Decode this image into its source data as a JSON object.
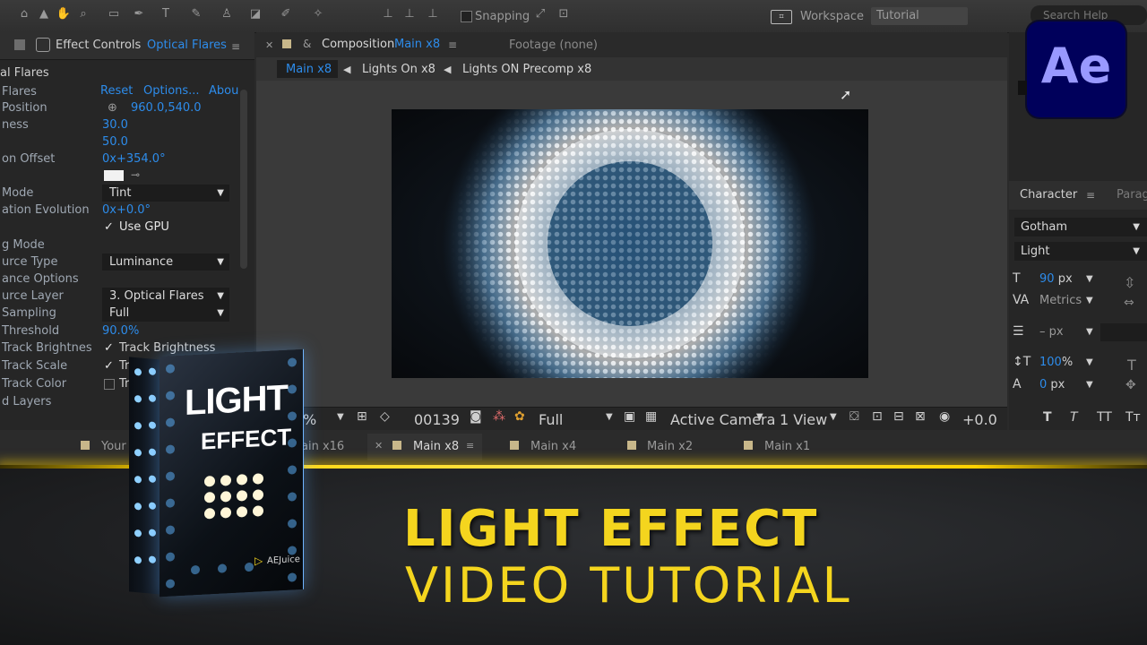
{
  "top_toolbar": {
    "snapping_label": "Snapping",
    "workspace_label": "Workspace",
    "workspace_value": "Tutorial",
    "search_placeholder": "Search Help",
    "icons": [
      "home-icon",
      "selection-tool-icon",
      "hand-tool-icon",
      "zoom-tool-icon",
      "camera-tool-icon",
      "pan-behind-tool-icon",
      "rectangle-tool-icon",
      "pen-tool-icon",
      "type-tool-icon",
      "brush-tool-icon",
      "clone-stamp-tool-icon",
      "eraser-tool-icon",
      "roto-brush-tool-icon",
      "puppet-pin-tool-icon",
      "axis-icon",
      "magnet-icon"
    ]
  },
  "effect_controls": {
    "tab_label": "Effect Controls",
    "layer_name": "Optical Flares",
    "effect_name": "al Flares",
    "reset": "Reset",
    "options": "Options...",
    "about": "Abou",
    "rows": [
      {
        "name": "Flares",
        "value": ""
      },
      {
        "name": "Position",
        "value": "960.0,540.0"
      },
      {
        "name": "ness",
        "value": "30.0"
      },
      {
        "name": "",
        "value": "50.0"
      },
      {
        "name": "on Offset",
        "value": "0x+354.0°"
      },
      {
        "name": "Mode",
        "value": "Tint"
      },
      {
        "name": "ation Evolution",
        "value": "0x+0.0°"
      },
      {
        "name": "",
        "value": "Use GPU"
      },
      {
        "name": "g Mode",
        "value": ""
      },
      {
        "name": "urce Type",
        "value": "Luminance"
      },
      {
        "name": "ance Options",
        "value": ""
      },
      {
        "name": "urce Layer",
        "value": "3. Optical Flares"
      },
      {
        "name": "Sampling",
        "value": "Full"
      },
      {
        "name": "Threshold",
        "value": "90.0%"
      },
      {
        "name": "Track Brightnes",
        "value": "Track Brightness"
      },
      {
        "name": "Track Scale",
        "value": "Tr"
      },
      {
        "name": "Track Color",
        "value": "Tr"
      },
      {
        "name": "d Layers",
        "value": ""
      }
    ]
  },
  "composition": {
    "tab_prefix": "Composition",
    "tab_name": "Main x8",
    "footage_label": "Footage (none)",
    "breadcrumbs": [
      "Main x8",
      "Lights On x8",
      "Lights ON Precomp x8"
    ],
    "footer": {
      "zoom": "%",
      "frame": "00139",
      "resolution": "Full",
      "camera": "Active Camera",
      "view": "1 View",
      "exposure": "+0.0"
    }
  },
  "character_panel": {
    "title": "Character",
    "next_tab": "Parag",
    "font_family": "Gotham",
    "font_style": "Light",
    "font_size": "90",
    "font_size_unit": "px",
    "kerning": "Metrics",
    "leading": "– px",
    "vertical_scale": "100",
    "vertical_scale_unit": "%",
    "baseline_shift": "0",
    "baseline_unit": "px",
    "style_buttons": [
      "T",
      "T",
      "TT",
      "Tт"
    ]
  },
  "timeline_tabs": [
    {
      "label": "Your"
    },
    {
      "label": "ain x16"
    },
    {
      "label": "Main x8"
    },
    {
      "label": "Main x4"
    },
    {
      "label": "Main x2"
    },
    {
      "label": "Main x1"
    }
  ],
  "brand_logo": "Ae",
  "overlay": {
    "title_line_1": "LIGHT EFFECT",
    "title_line_2": "VIDEO TUTORIAL",
    "box_title_1": "LIGHT",
    "box_title_2": "EFFECT",
    "box_brand": "AEJuice"
  },
  "colors": {
    "accent_yellow": "#f4d51e",
    "ae_purple": "#9999ff",
    "ae_bg": "#00005b",
    "value_blue": "#2d8ceb",
    "glow_blue": "#6fc3ff"
  }
}
